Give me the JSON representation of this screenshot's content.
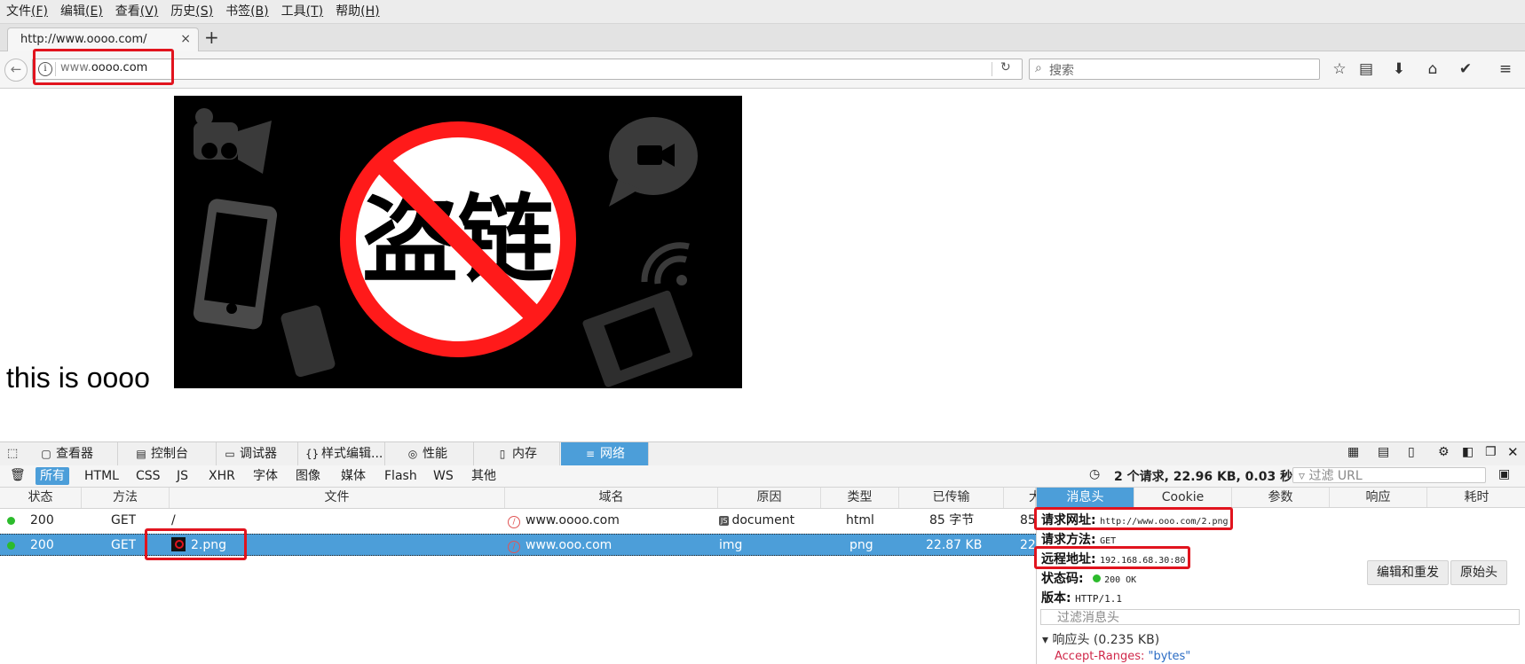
{
  "menu": [
    {
      "label": "文件",
      "key": "(F)"
    },
    {
      "label": "编辑",
      "key": "(E)"
    },
    {
      "label": "查看",
      "key": "(V)"
    },
    {
      "label": "历史",
      "key": "(S)"
    },
    {
      "label": "书签",
      "key": "(B)"
    },
    {
      "label": "工具",
      "key": "(T)"
    },
    {
      "label": "帮助",
      "key": "(H)"
    }
  ],
  "tab": {
    "title": "http://www.oooo.com/",
    "close": "×",
    "new_tab": "+"
  },
  "nav": {
    "url_prefix": "www.",
    "url_domain": "oooo.com",
    "search_placeholder": "搜索"
  },
  "page": {
    "text": "this is oooo",
    "image_text": "盗链"
  },
  "devtools": {
    "tools": [
      {
        "icon": "▢",
        "label": "查看器"
      },
      {
        "icon": "▤",
        "label": "控制台"
      },
      {
        "icon": "▭",
        "label": "调试器"
      },
      {
        "icon": "{}",
        "label": "样式编辑..."
      },
      {
        "icon": "◎",
        "label": "性能"
      },
      {
        "icon": "▯",
        "label": "内存"
      },
      {
        "icon": "≡",
        "label": "网络"
      }
    ],
    "filters": [
      "所有",
      "HTML",
      "CSS",
      "JS",
      "XHR",
      "字体",
      "图像",
      "媒体",
      "Flash",
      "WS",
      "其他"
    ],
    "summary": "2 个请求, 22.96 KB, 0.03 秒",
    "filter_url_placeholder": "过滤 URL",
    "columns": [
      "状态",
      "方法",
      "文件",
      "域名",
      "原因",
      "类型",
      "已传输",
      "大"
    ],
    "rows": [
      {
        "status": "200",
        "method": "GET",
        "file": "/",
        "domain": "www.oooo.com",
        "cause": "document",
        "cause_badge": "JS",
        "type": "html",
        "transferred": "85 字节",
        "size": "85"
      },
      {
        "status": "200",
        "method": "GET",
        "file": "2.png",
        "domain": "www.ooo.com",
        "cause": "img",
        "cause_badge": "",
        "type": "png",
        "transferred": "22.87 KB",
        "size": "22"
      }
    ],
    "panel": {
      "tabs": [
        "消息头",
        "Cookie",
        "参数",
        "响应",
        "耗时"
      ],
      "request_url_label": "请求网址:",
      "request_url": "http://www.ooo.com/2.png",
      "method_label": "请求方法:",
      "method": "GET",
      "remote_label": "远程地址:",
      "remote": "192.168.68.30:80",
      "status_label": "状态码:",
      "status": "200  OK",
      "version_label": "版本:",
      "version": "HTTP/1.1",
      "edit_resend": "编辑和重发",
      "raw_headers": "原始头",
      "filter_headers_placeholder": "过滤消息头",
      "response_headers": "响应头 (0.235 KB)",
      "accept_ranges_key": "Accept-Ranges:",
      "accept_ranges_value": "\"bytes\""
    }
  },
  "colors": {
    "accent": "#4c9ed9",
    "highlight": "#e1141e",
    "status_ok": "#2cbb2c"
  }
}
